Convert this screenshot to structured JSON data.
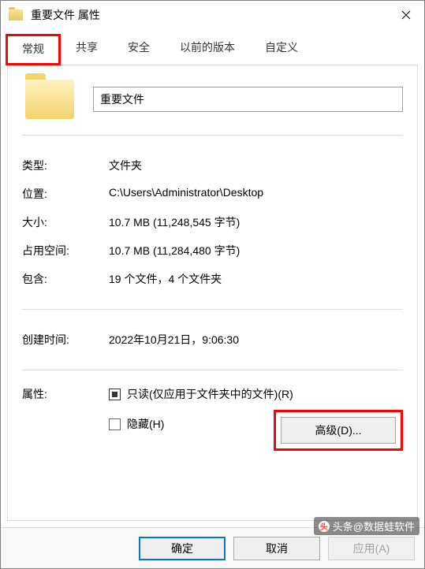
{
  "window": {
    "title": "重要文件 属性"
  },
  "tabs": {
    "general": "常规",
    "sharing": "共享",
    "security": "安全",
    "previous": "以前的版本",
    "custom": "自定义"
  },
  "folder": {
    "name": "重要文件"
  },
  "properties": {
    "type_label": "类型:",
    "type_value": "文件夹",
    "location_label": "位置:",
    "location_value": "C:\\Users\\Administrator\\Desktop",
    "size_label": "大小:",
    "size_value": "10.7 MB (11,248,545 字节)",
    "sizeondisk_label": "占用空间:",
    "sizeondisk_value": "10.7 MB (11,284,480 字节)",
    "contains_label": "包含:",
    "contains_value": "19 个文件，4 个文件夹",
    "created_label": "创建时间:",
    "created_value": "2022年10月21日，9:06:30"
  },
  "attributes": {
    "label": "属性:",
    "readonly": "只读(仅应用于文件夹中的文件)(R)",
    "hidden": "隐藏(H)",
    "advanced": "高级(D)..."
  },
  "buttons": {
    "ok": "确定",
    "cancel": "取消",
    "apply": "应用(A)"
  },
  "watermark": {
    "text": "头条@数据蛙软件"
  }
}
